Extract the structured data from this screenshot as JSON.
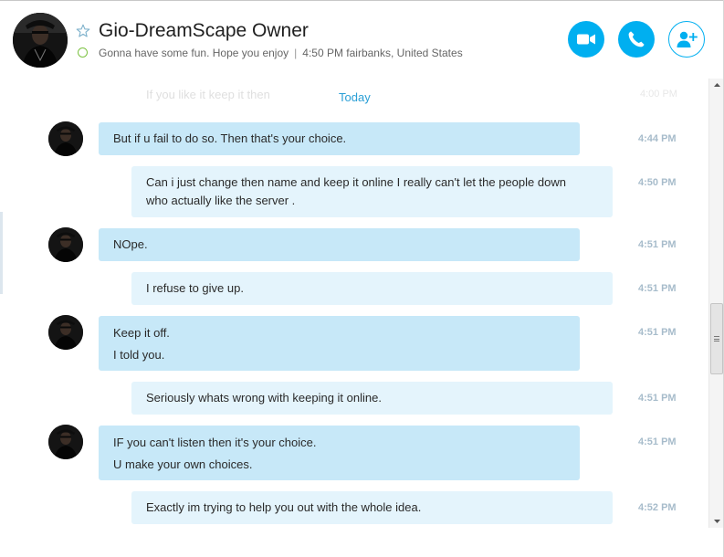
{
  "header": {
    "contact_name": "Gio-DreamScape Owner",
    "mood_message": "Gonna have some fun. Hope you enjoy",
    "local_time": "4:50 PM fairbanks, United States",
    "presence": "online",
    "accent_color": "#00aff0",
    "buttons": [
      {
        "name": "video-call",
        "icon": "video-camera-icon"
      },
      {
        "name": "audio-call",
        "icon": "phone-icon"
      },
      {
        "name": "add-people",
        "icon": "add-person-icon"
      }
    ]
  },
  "chat": {
    "faded_previous": {
      "text": "If you like it keep it then",
      "time": "4:00 PM"
    },
    "day_separator": "Today",
    "messages": [
      {
        "direction": "in",
        "lines": [
          "But if u fail to do so. Then that's your choice."
        ],
        "time": "4:44 PM"
      },
      {
        "direction": "out",
        "lines": [
          "Can i just change then name and keep it online I really can't let the people down",
          "who actually like the server ."
        ],
        "time": "4:50 PM"
      },
      {
        "direction": "in",
        "lines": [
          "NOpe."
        ],
        "time": "4:51 PM"
      },
      {
        "direction": "out",
        "lines": [
          "I refuse to give up."
        ],
        "time": "4:51 PM"
      },
      {
        "direction": "in",
        "lines": [
          "Keep it off.",
          "I told you."
        ],
        "time": "4:51 PM"
      },
      {
        "direction": "out",
        "lines": [
          "Seriously whats wrong with keeping it online."
        ],
        "time": "4:51 PM"
      },
      {
        "direction": "in",
        "lines": [
          "IF you can't listen then it's your choice.",
          "U make your own choices."
        ],
        "time": "4:51 PM"
      },
      {
        "direction": "out",
        "lines": [
          "Exactly im trying to help you out with the whole idea."
        ],
        "time": "4:52 PM"
      }
    ]
  }
}
